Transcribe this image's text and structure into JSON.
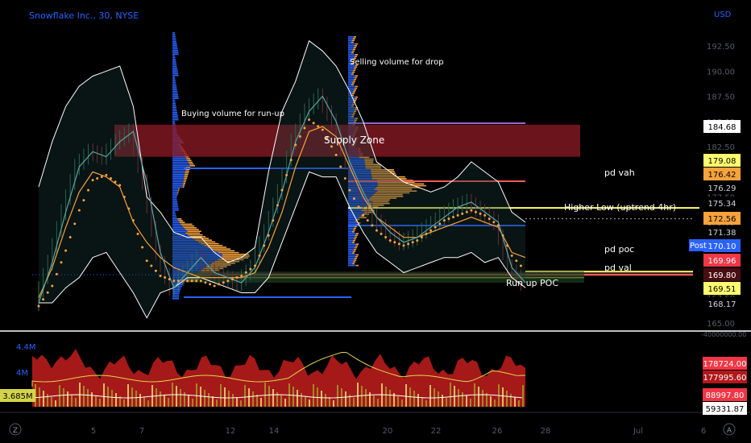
{
  "header": {
    "symbol": "Snowflake Inc., 30, NYSE",
    "currency": "USD"
  },
  "price_axis": {
    "ticks": [
      "192.50",
      "190.00",
      "187.50",
      "185.00",
      "182.50",
      "180.00",
      "177.50",
      "175.00",
      "172.50",
      "170.00",
      "167.50",
      "165.00"
    ],
    "bottom_label": "-40000000.00"
  },
  "time_axis": {
    "corner": "Z",
    "ticks": [
      "5",
      "7",
      "12",
      "14",
      "20",
      "22",
      "26",
      "28",
      "Jul",
      "6"
    ],
    "auto": "A"
  },
  "annotations": {
    "buying": "Buying volume for run-up",
    "selling": "Selling volume for drop",
    "supply": "Supply Zone",
    "pd_vah": "pd vah",
    "higher_low": "Higher Low (uptrend 4hr)",
    "pd_poc": "pd poc",
    "pd_val": "pd val",
    "run_up_poc": "Run up POC"
  },
  "price_tags": [
    {
      "text": "184.68",
      "bg": "#ffffff",
      "fg": "#000000"
    },
    {
      "text": "179.08",
      "bg": "#ffff6e",
      "fg": "#000000"
    },
    {
      "text": "176.42",
      "bg": "#f7a23b",
      "fg": "#000000"
    },
    {
      "text": "176.29",
      "bg": "#000000",
      "fg": "#d1d4dc"
    },
    {
      "text": "175.34",
      "bg": "#000000",
      "fg": "#d1d4dc"
    },
    {
      "text": "172.56",
      "bg": "#f7a23b",
      "fg": "#000000"
    },
    {
      "text": "171.38",
      "bg": "#000000",
      "fg": "#d1d4dc"
    },
    {
      "text": "170.10",
      "bg": "#2962ff",
      "fg": "#ffffff"
    },
    {
      "text": "169.96",
      "bg": "#f23645",
      "fg": "#ffffff"
    },
    {
      "text": "169.80",
      "bg": "#4a0e12",
      "fg": "#ffffff"
    },
    {
      "text": "169.51",
      "bg": "#ffff6e",
      "fg": "#000000"
    },
    {
      "text": "168.17",
      "bg": "#000000",
      "fg": "#d1d4dc"
    }
  ],
  "post_badge": "Post",
  "volume_pane": {
    "ticks": [
      "4.4M",
      "4M"
    ],
    "value_tag": "3.685M",
    "tags": [
      {
        "text": "178724.00",
        "bg": "#f23645",
        "fg": "#ffffff"
      },
      {
        "text": "177995.60",
        "bg": "#b2181b",
        "fg": "#ffffff"
      },
      {
        "text": "88997.80",
        "bg": "#f23645",
        "fg": "#ffffff"
      },
      {
        "text": "59331.87",
        "bg": "#ffffff",
        "fg": "#000000"
      }
    ]
  },
  "colors": {
    "bollinger": "#ffffff",
    "vwap_dots": "#f7a23b",
    "ema": "#f7a23b",
    "supply_zone": "#8b1a24",
    "level_blue": "#2962ff",
    "level_red": "#f25a5a",
    "level_yellow": "#ffff6e",
    "profile_blue": "#2962ff",
    "profile_orange": "#f7a23b"
  },
  "chart_data": {
    "type": "line",
    "title": "Snowflake Inc., 30, NYSE",
    "y_unit": "USD",
    "ylim": [
      165,
      193.5
    ],
    "x_ticks": [
      "5",
      "7",
      "12",
      "14",
      "20",
      "22",
      "26",
      "28",
      "Jul",
      "6"
    ],
    "series": [
      {
        "values": [
          167.0,
          171.0,
          176.0,
          180.5,
          182.0,
          181.5,
          183.0,
          184.0,
          179.0,
          172.0,
          168.5,
          170.0,
          171.5,
          170.0,
          169.5,
          169.0,
          170.5,
          174.0,
          178.0,
          183.0,
          186.0,
          187.5,
          185.0,
          181.0,
          178.0,
          175.5,
          174.0,
          173.0,
          173.5,
          174.5,
          175.5,
          176.5,
          177.0,
          176.0,
          175.0,
          170.5,
          169.0
        ]
      },
      {
        "values": [
          178.5,
          183.0,
          186.5,
          188.5,
          189.5,
          190.0,
          190.5,
          186.5,
          177.5,
          176.0,
          174.0,
          173.5,
          173.5,
          172.0,
          171.0,
          171.5,
          172.5,
          180.0,
          186.0,
          189.0,
          193.0,
          192.0,
          190.5,
          188.0,
          185.0,
          181.0,
          180.0,
          179.0,
          178.5,
          178.0,
          178.5,
          179.5,
          181.0,
          180.0,
          179.0,
          176.0,
          175.0
        ]
      },
      {
        "values": [
          167.0,
          167.0,
          168.5,
          169.5,
          171.5,
          172.0,
          170.0,
          168.0,
          165.5,
          168.0,
          168.5,
          169.5,
          169.5,
          169.0,
          168.5,
          168.0,
          168.0,
          169.5,
          173.0,
          176.5,
          180.0,
          179.5,
          179.5,
          176.5,
          174.0,
          172.0,
          171.0,
          170.0,
          170.5,
          171.0,
          171.5,
          171.5,
          172.0,
          171.0,
          171.5,
          169.5,
          168.5
        ]
      },
      {
        "values": [
          167.5,
          170.5,
          174.5,
          178.0,
          180.0,
          179.5,
          178.5,
          175.0,
          173.0,
          171.5,
          170.5,
          170.0,
          169.5,
          169.5,
          169.5,
          169.5,
          170.0,
          172.5,
          176.0,
          180.5,
          184.0,
          184.5,
          183.5,
          180.5,
          177.5,
          175.5,
          174.5,
          173.5,
          173.5,
          174.0,
          174.5,
          175.0,
          175.5,
          175.0,
          174.5,
          172.0,
          171.5
        ]
      },
      {
        "values": [
          167.0,
          169.0,
          172.5,
          176.5,
          179.5,
          180.0,
          179.0,
          175.5,
          171.5,
          170.0,
          169.5,
          169.5,
          169.5,
          169.0,
          169.5,
          170.0,
          171.0,
          174.0,
          178.5,
          183.0,
          185.5,
          184.5,
          182.0,
          178.5,
          176.0,
          174.5,
          173.5,
          173.0,
          173.5,
          174.5,
          175.5,
          176.0,
          176.5,
          176.0,
          175.0,
          172.0,
          170.5
        ]
      }
    ],
    "levels": [
      {
        "label": "pd vah",
        "value": 176.42
      },
      {
        "label": "Higher Low (uptrend 4hr)",
        "value": 175.34
      },
      {
        "label": "pd poc",
        "value": 170.1
      },
      {
        "label": "pd val",
        "value": 169.8
      },
      {
        "label": "Run up POC",
        "value": 169.51
      }
    ],
    "zones": [
      {
        "label": "Supply Zone",
        "from": 181.5,
        "to": 184.68
      }
    ]
  }
}
